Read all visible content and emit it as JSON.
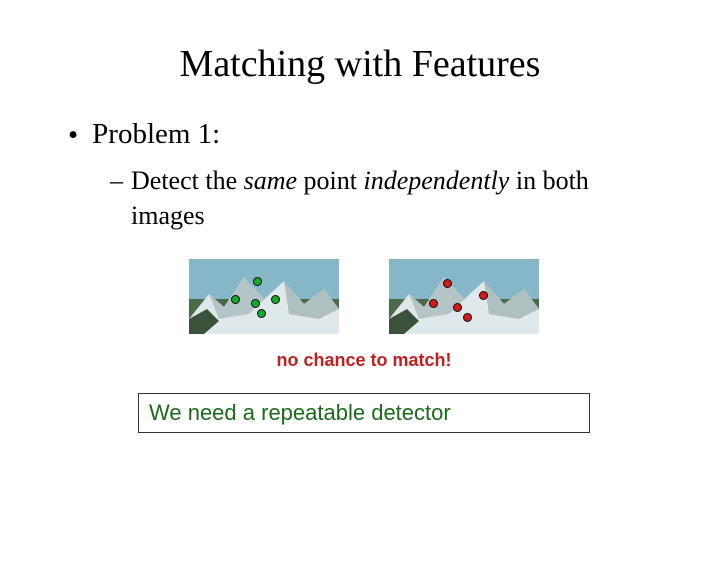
{
  "title": "Matching with Features",
  "bullet1": "Problem 1:",
  "bullet2_parts": {
    "pre": "Detect the ",
    "same": "same",
    "mid": " point ",
    "indep": "independently",
    "post": " in both images"
  },
  "caption": "no chance to match!",
  "box": "We need a repeatable detector",
  "points_left": [
    {
      "x": 68,
      "y": 22
    },
    {
      "x": 46,
      "y": 40
    },
    {
      "x": 66,
      "y": 44
    },
    {
      "x": 86,
      "y": 40
    },
    {
      "x": 72,
      "y": 54
    }
  ],
  "points_right": [
    {
      "x": 58,
      "y": 24
    },
    {
      "x": 44,
      "y": 44
    },
    {
      "x": 68,
      "y": 48
    },
    {
      "x": 94,
      "y": 36
    },
    {
      "x": 78,
      "y": 58
    }
  ]
}
